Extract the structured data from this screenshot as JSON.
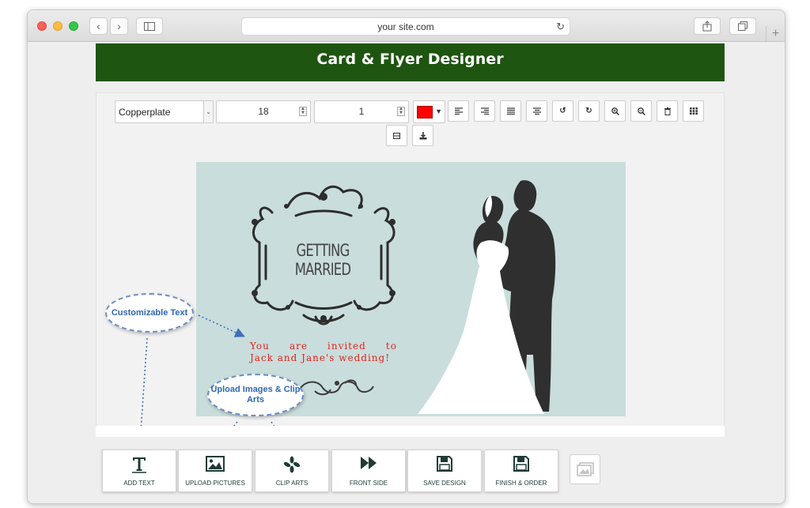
{
  "browser": {
    "url": "your site.com"
  },
  "header": {
    "title": "Card & Flyer Designer"
  },
  "toolbar": {
    "font_family": "Copperplate",
    "font_size": "18",
    "line_value": "1",
    "text_color": "#ff0000",
    "tools": [
      "align-left-icon",
      "align-right-icon",
      "justify-icon",
      "align-center-icon",
      "undo-icon",
      "redo-icon",
      "zoom-in-icon",
      "zoom-out-icon",
      "delete-icon",
      "grid-icon",
      "fit-icon",
      "download-icon"
    ]
  },
  "card": {
    "heading": "GETTING MARRIED",
    "invite_line1_words": [
      "You",
      "are",
      "invited",
      "to"
    ],
    "invite_line2": "Jack and Jane's wedding!",
    "background_color": "#c9dddc"
  },
  "callouts": {
    "text_callout": "Customizable Text",
    "upload_callout": "Upload Images & Clip Arts"
  },
  "bottom_buttons": [
    {
      "label": "ADD TEXT",
      "icon": "text-icon"
    },
    {
      "label": "UPLOAD PICTURES",
      "icon": "picture-icon"
    },
    {
      "label": "CLIP ARTS",
      "icon": "clipart-icon"
    },
    {
      "label": "FRONT SIDE",
      "icon": "fast-forward-icon"
    },
    {
      "label": "SAVE DESIGN",
      "icon": "floppy-icon"
    },
    {
      "label": "FINISH & ORDER",
      "icon": "floppy-icon"
    }
  ],
  "colors": {
    "header_bg": "#1e5510",
    "callout_text": "#2e67b5",
    "invite_text": "#e0241b"
  }
}
